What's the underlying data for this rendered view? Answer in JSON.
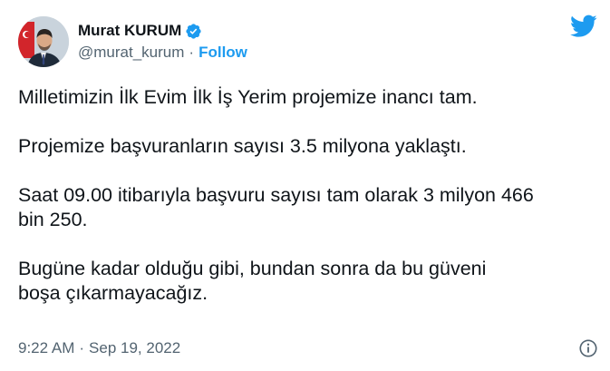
{
  "author": {
    "display_name": "Murat KURUM",
    "handle": "@murat_kurum",
    "separator": "·",
    "follow_label": "Follow",
    "verified_icon": "verified-badge-icon",
    "avatar": "profile-photo"
  },
  "brand": {
    "logo_icon": "twitter-bird-icon",
    "accent_color": "#1d9bf0"
  },
  "tweet": {
    "paragraphs": [
      "Milletimizin İlk Evim İlk İş Yerim projemize inancı tam.",
      "Projemize başvuranların sayısı 3.5 milyona yaklaştı.",
      "Saat 09.00 itibarıyla başvuru sayısı tam olarak 3 milyon 466\nbin 250.",
      "Bugüne kadar olduğu gibi, bundan sonra da bu güveni\nboşa çıkarmayacağız."
    ]
  },
  "footer": {
    "time": "9:22 AM",
    "separator": "·",
    "date": "Sep 19, 2022",
    "info_icon": "info-icon"
  }
}
